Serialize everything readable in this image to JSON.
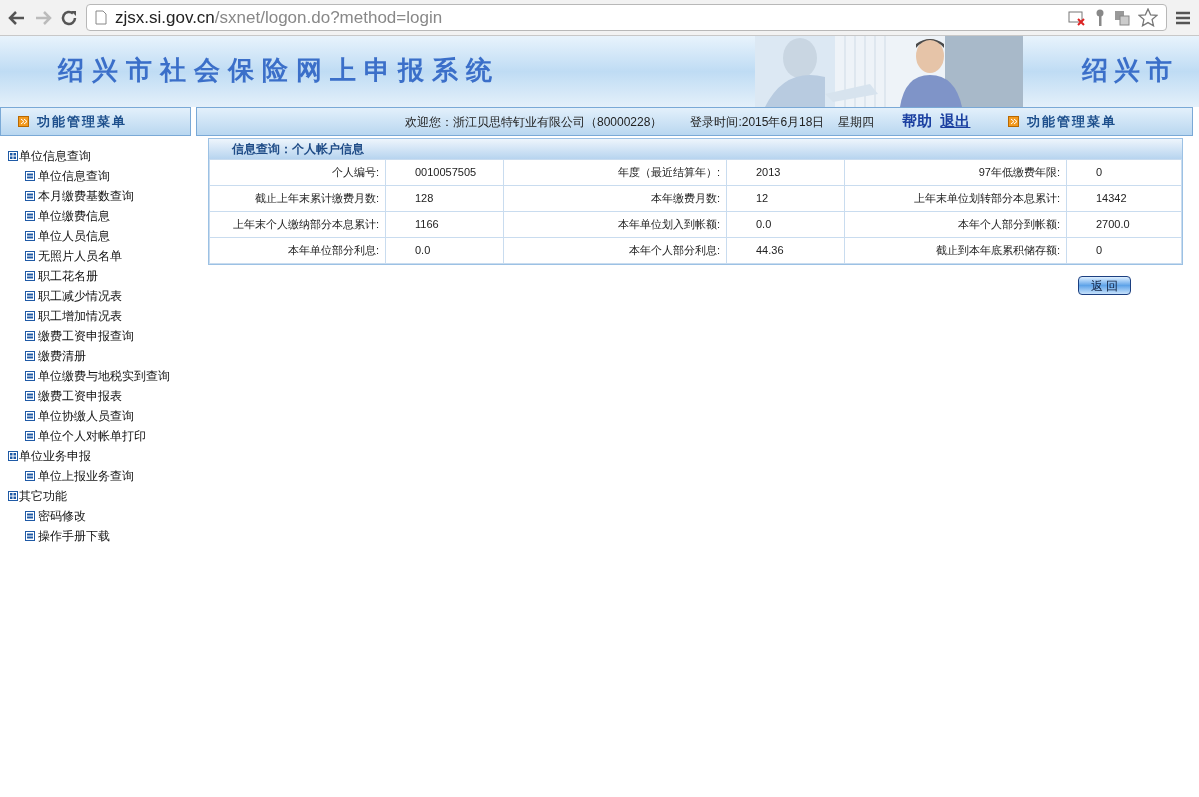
{
  "browser": {
    "url_host": "zjsx.si.gov.cn",
    "url_path": "/sxnet/logon.do?method=login"
  },
  "header": {
    "title": "绍兴市社会保险网上申报系统",
    "title_repeat": "绍兴市"
  },
  "menu_bar": {
    "left_label": "功能管理菜单",
    "welcome": "欢迎您：浙江贝思特钉业有限公司（80000228）",
    "login_time": "登录时间:2015年6月18日",
    "weekday": "星期四",
    "help": "帮助",
    "logout": "退出",
    "right_label": "功能管理菜单"
  },
  "sidebar": {
    "items": [
      {
        "label": "单位信息查询",
        "children": [
          {
            "label": "单位信息查询"
          },
          {
            "label": "本月缴费基数查询"
          },
          {
            "label": "单位缴费信息"
          },
          {
            "label": "单位人员信息"
          },
          {
            "label": "无照片人员名单"
          },
          {
            "label": "职工花名册"
          },
          {
            "label": "职工减少情况表"
          },
          {
            "label": "职工增加情况表"
          },
          {
            "label": "缴费工资申报查询"
          },
          {
            "label": "缴费清册"
          },
          {
            "label": "单位缴费与地税实到查询"
          },
          {
            "label": "缴费工资申报表"
          },
          {
            "label": "单位协缴人员查询"
          },
          {
            "label": "单位个人对帐单打印"
          }
        ]
      },
      {
        "label": "单位业务申报",
        "children": [
          {
            "label": "单位上报业务查询"
          }
        ]
      },
      {
        "label": "其它功能",
        "children": [
          {
            "label": "密码修改"
          },
          {
            "label": "操作手册下载"
          }
        ]
      }
    ]
  },
  "panel": {
    "title": "信息查询：个人帐户信息",
    "rows": [
      [
        {
          "label": "个人编号:",
          "value": "0010057505"
        },
        {
          "label": "年度（最近结算年）:",
          "value": "2013"
        },
        {
          "label": "97年低缴费年限:",
          "value": "0"
        }
      ],
      [
        {
          "label": "截止上年末累计缴费月数:",
          "value": "128"
        },
        {
          "label": "本年缴费月数:",
          "value": "12"
        },
        {
          "label": "上年末单位划转部分本息累计:",
          "value": "14342"
        }
      ],
      [
        {
          "label": "上年末个人缴纳部分本息累计:",
          "value": "1166"
        },
        {
          "label": "本年单位划入到帐额:",
          "value": "0.0"
        },
        {
          "label": "本年个人部分到帐额:",
          "value": "2700.0"
        }
      ],
      [
        {
          "label": "本年单位部分利息:",
          "value": "0.0"
        },
        {
          "label": "本年个人部分利息:",
          "value": "44.36"
        },
        {
          "label": "截止到本年底累积储存额:",
          "value": "0"
        }
      ]
    ],
    "button": "返 回"
  }
}
